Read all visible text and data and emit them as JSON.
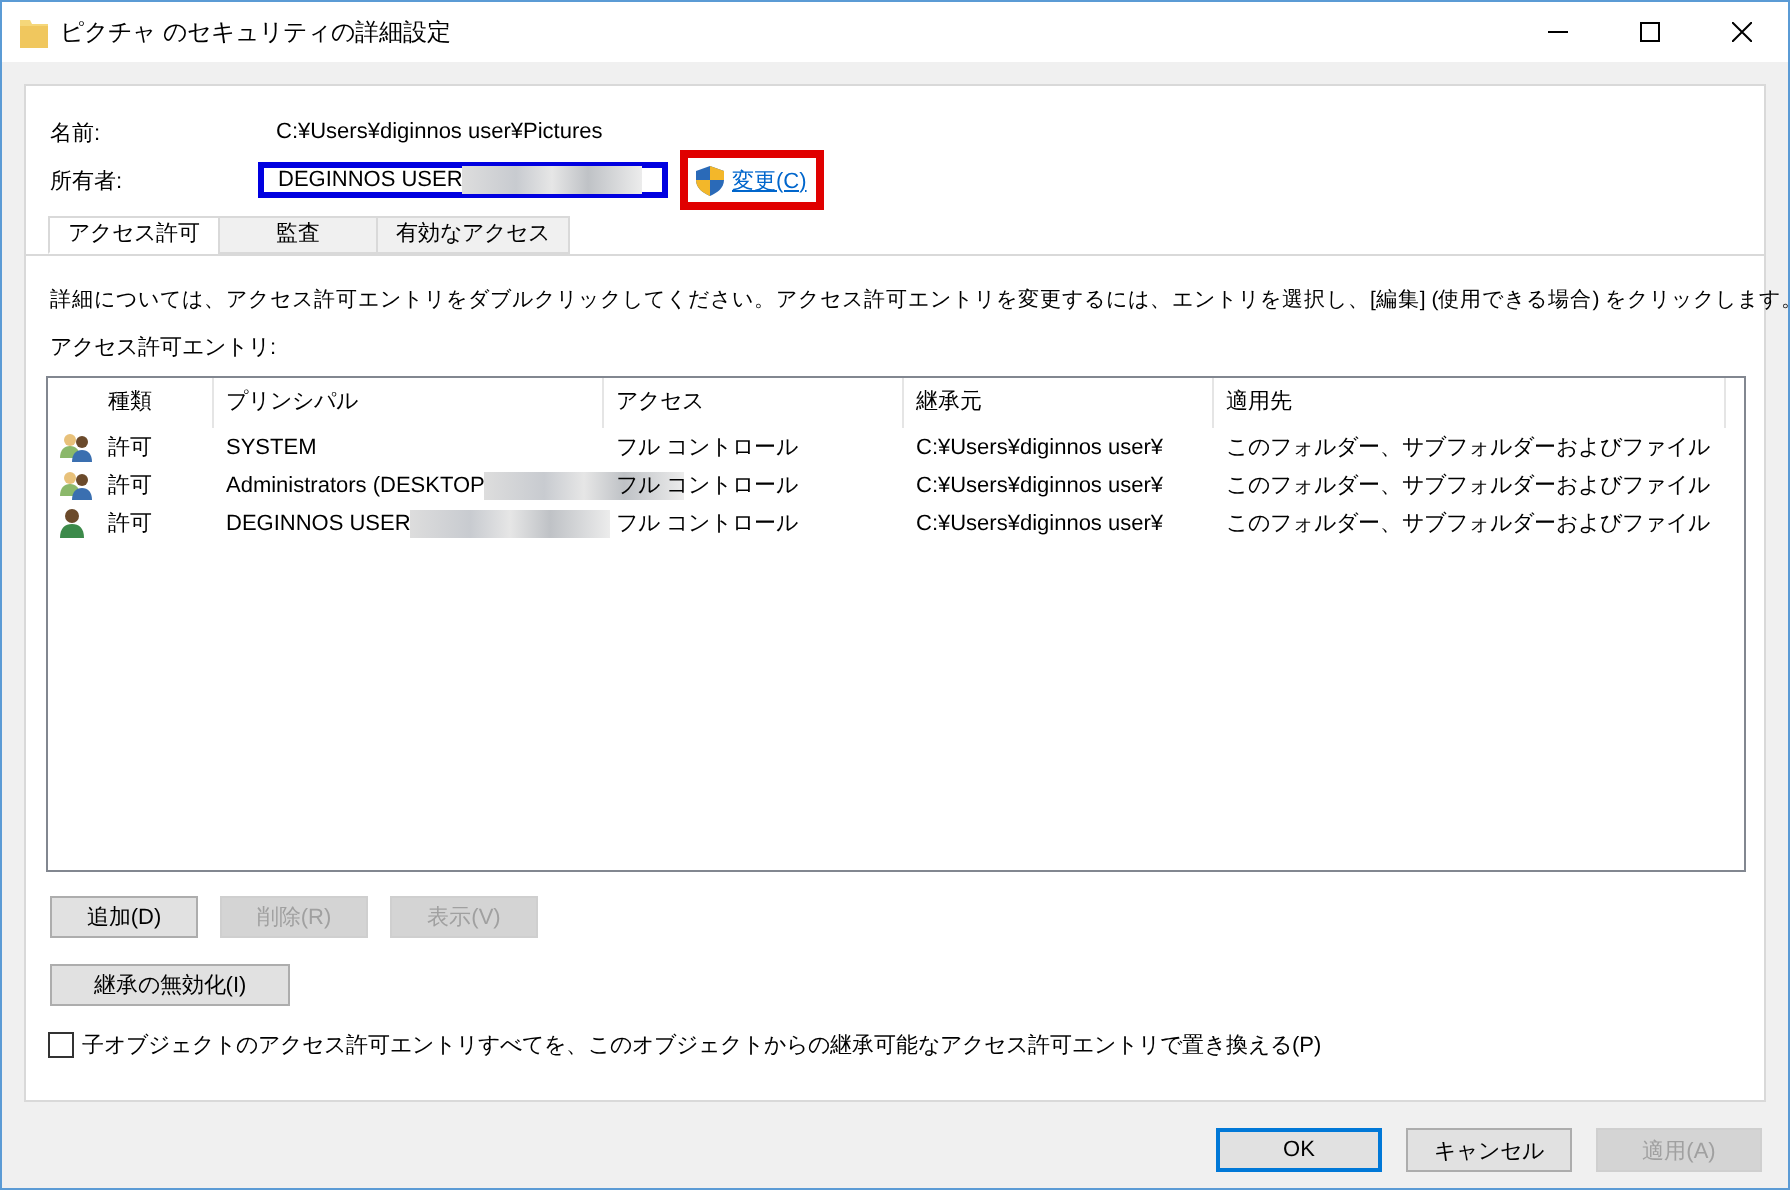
{
  "window": {
    "title": "ピクチャ のセキュリティの詳細設定"
  },
  "name_label": "名前:",
  "name_value": "C:¥Users¥diginnos user¥Pictures",
  "owner_label": "所有者:",
  "owner_value": "DEGINNOS USER",
  "change_link": "変更(C)",
  "tabs": [
    {
      "label": "アクセス許可",
      "selected": true
    },
    {
      "label": "監査",
      "selected": false
    },
    {
      "label": "有効なアクセス",
      "selected": false
    }
  ],
  "description": "詳細については、アクセス許可エントリをダブルクリックしてください。アクセス許可エントリを変更するには、エントリを選択し、[編集] (使用できる場合) をクリックします。",
  "entries_label": "アクセス許可エントリ:",
  "table": {
    "columns": [
      "種類",
      "プリンシパル",
      "アクセス",
      "継承元",
      "適用先"
    ],
    "rows": [
      {
        "kind": "group",
        "type": "許可",
        "principal": "SYSTEM",
        "redacted": false,
        "access": "フル コントロール",
        "inherited_from": "C:¥Users¥diginnos user¥",
        "applies_to": "このフォルダー、サブフォルダーおよびファイル"
      },
      {
        "kind": "group",
        "type": "許可",
        "principal": "Administrators (DESKTOP",
        "redacted": true,
        "access": "フル コントロール",
        "inherited_from": "C:¥Users¥diginnos user¥",
        "applies_to": "このフォルダー、サブフォルダーおよびファイル"
      },
      {
        "kind": "user",
        "type": "許可",
        "principal": "DEGINNOS USER",
        "redacted": true,
        "access": "フル コントロール",
        "inherited_from": "C:¥Users¥diginnos user¥",
        "applies_to": "このフォルダー、サブフォルダーおよびファイル"
      }
    ]
  },
  "entry_buttons": [
    {
      "label": "追加(D)",
      "disabled": false
    },
    {
      "label": "削除(R)",
      "disabled": true
    },
    {
      "label": "表示(V)",
      "disabled": true
    }
  ],
  "disable_inheritance_button": "継承の無効化(I)",
  "replace_checkbox": {
    "label": "子オブジェクトのアクセス許可エントリすべてを、このオブジェクトからの継承可能なアクセス許可エントリで置き換える(P)",
    "checked": false
  },
  "dialog_buttons": [
    {
      "label": "OK",
      "disabled": false,
      "default": true
    },
    {
      "label": "キャンセル",
      "disabled": false,
      "default": false
    },
    {
      "label": "適用(A)",
      "disabled": true,
      "default": false
    }
  ]
}
